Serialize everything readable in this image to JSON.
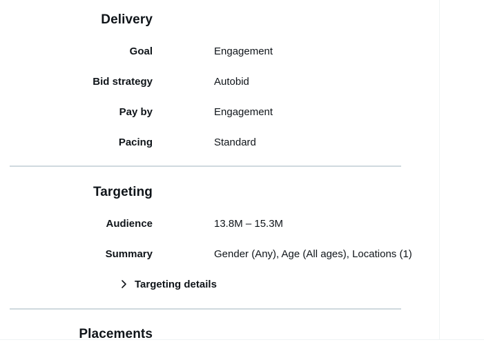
{
  "delivery": {
    "title": "Delivery",
    "rows": [
      {
        "label": "Goal",
        "value": "Engagement"
      },
      {
        "label": "Bid strategy",
        "value": "Autobid"
      },
      {
        "label": "Pay by",
        "value": "Engagement"
      },
      {
        "label": "Pacing",
        "value": "Standard"
      }
    ]
  },
  "targeting": {
    "title": "Targeting",
    "rows": [
      {
        "label": "Audience",
        "value": "13.8M – 15.3M"
      },
      {
        "label": "Summary",
        "value": "Gender (Any), Age (All ages), Locations (1)"
      }
    ],
    "details_label": "Targeting details",
    "details_icon": "chevron-right-icon"
  },
  "placements": {
    "title": "Placements"
  }
}
